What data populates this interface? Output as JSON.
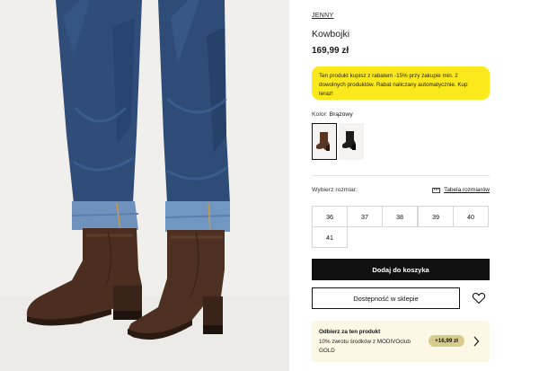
{
  "product": {
    "brand": "JENNY",
    "name": "Kowbojki",
    "price": "169,99 zł",
    "image_icon": "product-photo-boots-jeans"
  },
  "promo": {
    "text": "Ten produkt kupisz z rabatem -15% przy zakupie min. 2 dowolnych produktów. Rabat naliczany automatycznie. Kup teraz!",
    "color": "#fbe91e"
  },
  "color_selector": {
    "label": "Kolor:",
    "selected": "Brązowy",
    "swatches": [
      "brown-boot-icon",
      "black-boot-icon"
    ]
  },
  "sizes": {
    "label": "Wybierz rozmiar:",
    "guide_label": "Tabela rozmiarów",
    "guide_icon": "ruler-icon",
    "options": [
      "36",
      "37",
      "38",
      "39",
      "40",
      "41"
    ]
  },
  "actions": {
    "add_to_cart": "Dodaj do koszyka",
    "store_availability": "Dostępność w sklepie",
    "wishlist_icon": "heart-icon"
  },
  "loyalty": {
    "title": "Odbierz za ten produkt",
    "text": "10% zwrotu środków z MODIVOclub GOLD",
    "badge": "+16,99 zł",
    "badge_color": "#d8cc8c",
    "background": "#fdf7e6",
    "chevron_icon": "chevron-right-icon"
  }
}
